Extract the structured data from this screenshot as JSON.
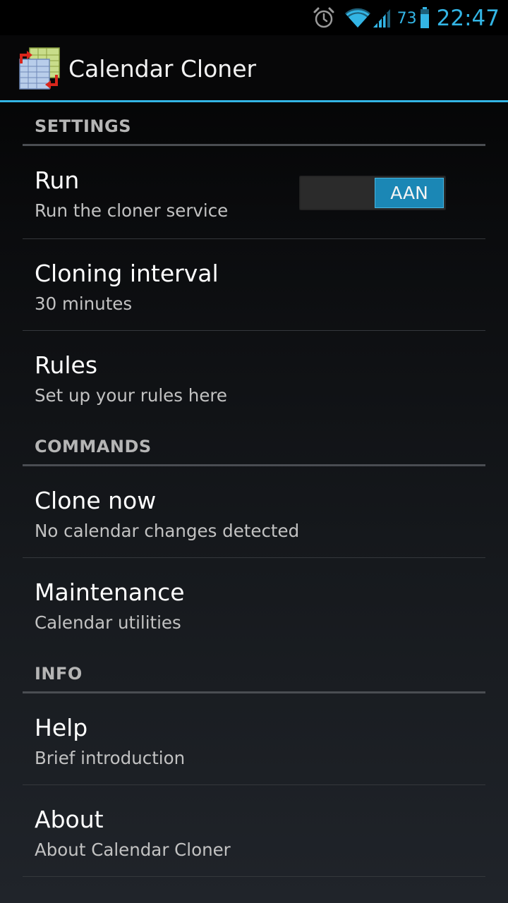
{
  "status_bar": {
    "battery_percent": "73",
    "time": "22:47",
    "icons": [
      "alarm-clock-icon",
      "wifi-icon",
      "cell-signal-icon",
      "battery-icon"
    ]
  },
  "action_bar": {
    "title": "Calendar Cloner",
    "icon": "calendar-cloner-app-icon"
  },
  "colors": {
    "accent": "#33b5e5",
    "switch_on": "#1b87b5"
  },
  "categories": {
    "settings": "SETTINGS",
    "commands": "COMMANDS",
    "info": "INFO"
  },
  "prefs": {
    "run": {
      "title": "Run",
      "summary": "Run the cloner service",
      "switch_label": "AAN",
      "switch_on": true
    },
    "interval": {
      "title": "Cloning interval",
      "summary": "30 minutes"
    },
    "rules": {
      "title": "Rules",
      "summary": "Set up your rules here"
    },
    "clone_now": {
      "title": "Clone now",
      "summary": "No calendar changes detected"
    },
    "maintenance": {
      "title": "Maintenance",
      "summary": "Calendar utilities"
    },
    "help": {
      "title": "Help",
      "summary": "Brief introduction"
    },
    "about": {
      "title": "About",
      "summary": "About Calendar Cloner"
    }
  }
}
